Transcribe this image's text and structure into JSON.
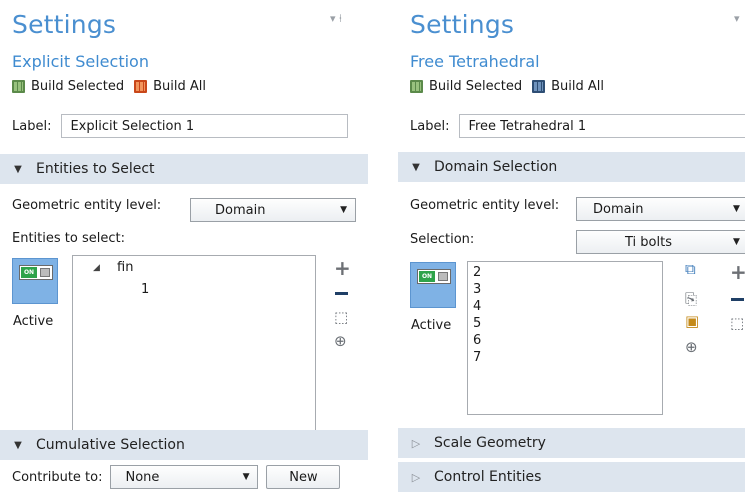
{
  "left": {
    "title": "Settings",
    "subtitle": "Explicit Selection",
    "toolbar": {
      "build_selected": "Build Selected",
      "build_all": "Build All"
    },
    "label_caption": "Label:",
    "label_value": "Explicit Selection 1",
    "entities_section": "Entities to Select",
    "geom_level_caption": "Geometric entity level:",
    "geom_level_value": "Domain",
    "entities_caption": "Entities to select:",
    "active_label": "Active",
    "toggle_text": "ON",
    "tree": {
      "parent": "fin",
      "child": "1"
    },
    "cumulative_section": "Cumulative Selection",
    "contribute_caption": "Contribute to:",
    "contribute_value": "None",
    "new_button": "New"
  },
  "right": {
    "title": "Settings",
    "subtitle": "Free Tetrahedral",
    "toolbar": {
      "build_selected": "Build Selected",
      "build_all": "Build All"
    },
    "label_caption": "Label:",
    "label_value": "Free Tetrahedral 1",
    "domain_section": "Domain Selection",
    "geom_level_caption": "Geometric entity level:",
    "geom_level_value": "Domain",
    "selection_caption": "Selection:",
    "selection_value": "Ti bolts",
    "active_label": "Active",
    "toggle_text": "ON",
    "domains": [
      "2",
      "3",
      "4",
      "5",
      "6",
      "7"
    ],
    "scale_section": "Scale Geometry",
    "control_section": "Control Entities"
  }
}
